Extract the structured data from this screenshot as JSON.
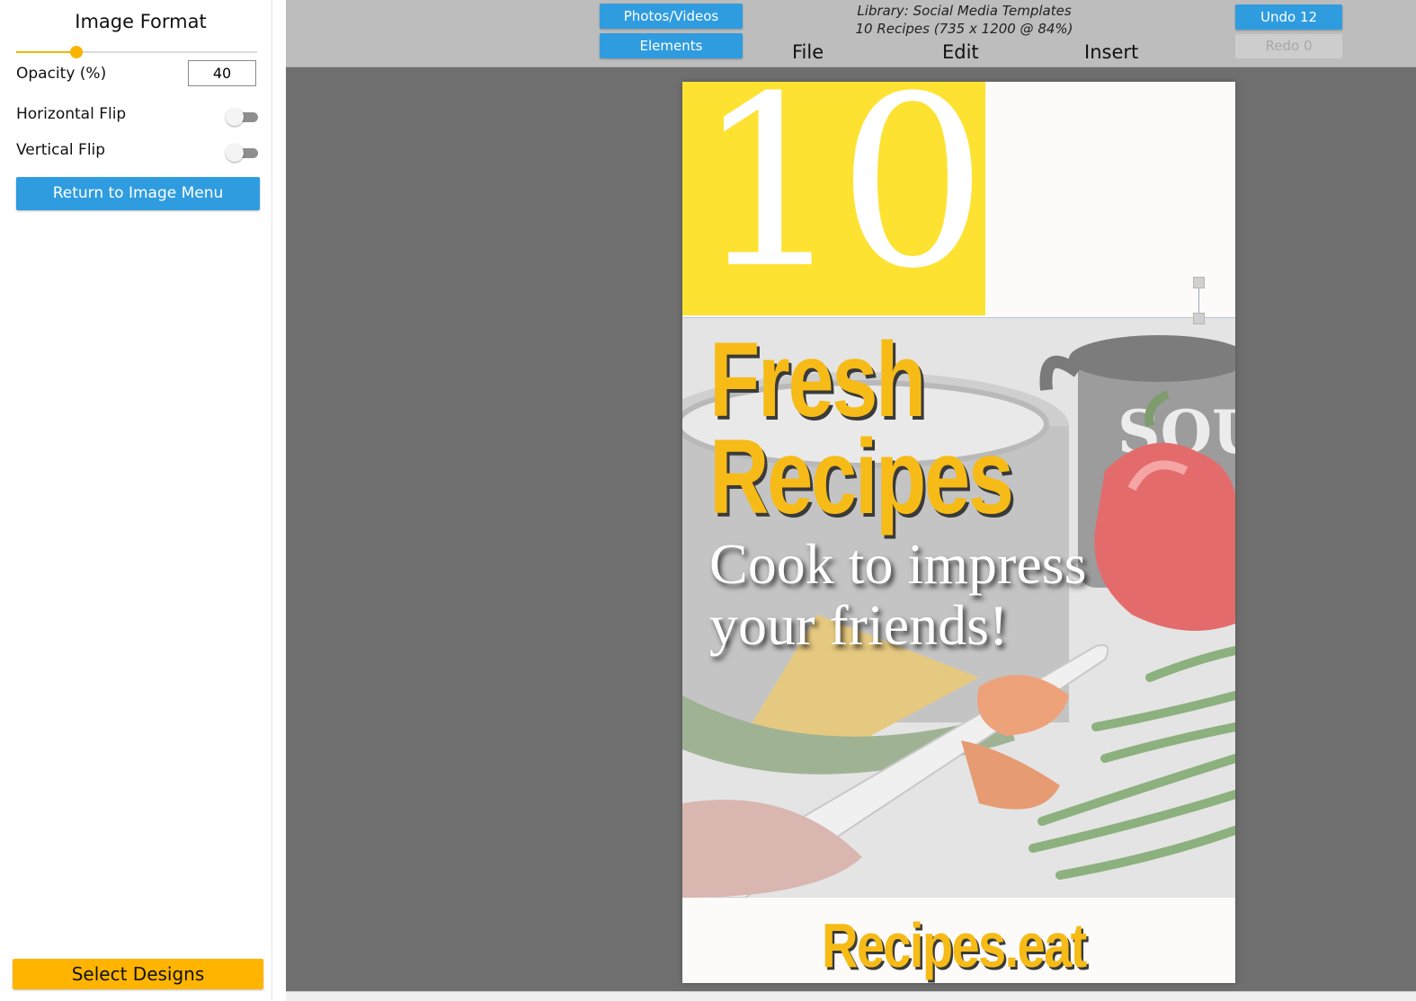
{
  "sidebar": {
    "title": "Image Format",
    "opacity_label": "Opacity (%)",
    "opacity_value": "40",
    "opacity_slider_fraction": 0.25,
    "horizontal_flip_label": "Horizontal Flip",
    "horizontal_flip_on": false,
    "vertical_flip_label": "Vertical Flip",
    "vertical_flip_on": false,
    "return_button": "Return to Image Menu",
    "select_designs_button": "Select Designs"
  },
  "toolbar": {
    "photos_videos": "Photos/Videos",
    "elements": "Elements",
    "library_line": "Library: Social Media Templates",
    "document_line": "10 Recipes  (735 x 1200 @ 84%)",
    "menu": [
      "File",
      "Edit",
      "Insert"
    ],
    "undo": "Undo 12",
    "redo": "Redo 0"
  },
  "design": {
    "big_number": "10",
    "title_line1": "Fresh",
    "title_line2": "Recipes",
    "subtitle_line1": "Cook to impress",
    "subtitle_line2": "your friends!",
    "pot_label": "SOU",
    "footer": "Recipes.eat"
  },
  "colors": {
    "accent_blue": "#2f9ce0",
    "accent_yellow": "#ffb400",
    "title_yellow": "#f6bb16",
    "number_box_yellow": "#fde232"
  }
}
